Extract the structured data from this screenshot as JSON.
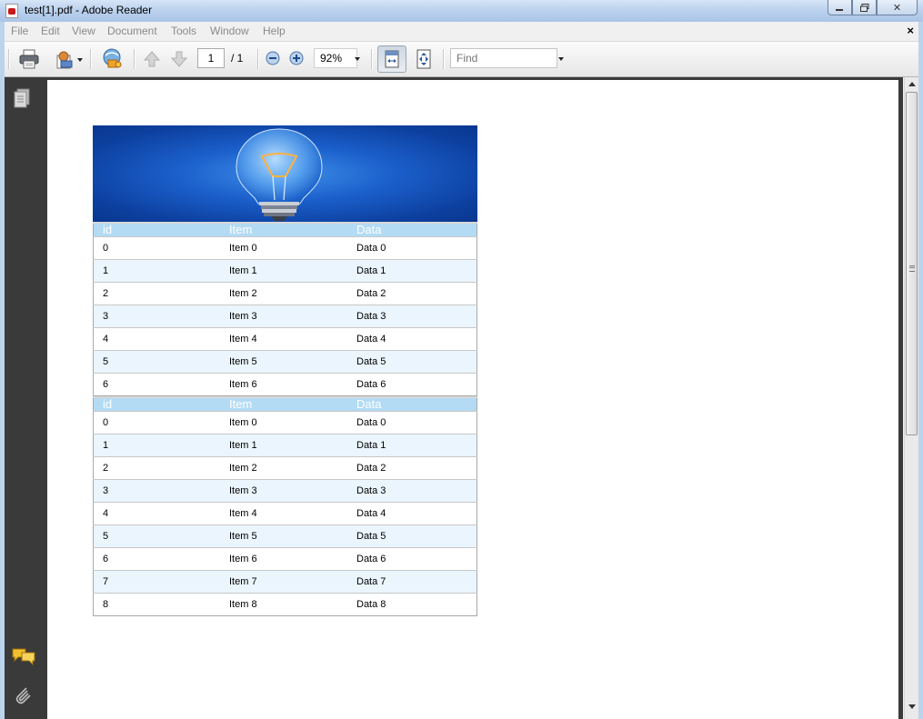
{
  "window": {
    "title": "test[1].pdf - Adobe Reader",
    "close_glyph": "✕"
  },
  "menu": {
    "items": [
      "File",
      "Edit",
      "View",
      "Document",
      "Tools",
      "Window",
      "Help"
    ],
    "close_glyph": "×"
  },
  "toolbar": {
    "page_current": "1",
    "page_total": "/ 1",
    "zoom": "92%",
    "find_placeholder": "Find",
    "icons": [
      "print-icon",
      "pdf-create-icon",
      "collaborate-icon",
      "previous-page-icon",
      "next-page-icon",
      "zoom-out-icon",
      "zoom-in-icon",
      "fit-width-icon",
      "fit-page-icon"
    ]
  },
  "leftnav": {
    "icons": [
      "pages-icon",
      "comments-icon",
      "attachments-icon"
    ]
  },
  "document": {
    "table1": {
      "headers": [
        "id",
        "Item",
        "Data"
      ],
      "rows": [
        [
          "0",
          "Item 0",
          "Data 0"
        ],
        [
          "1",
          "Item 1",
          "Data 1"
        ],
        [
          "2",
          "Item 2",
          "Data 2"
        ],
        [
          "3",
          "Item 3",
          "Data 3"
        ],
        [
          "4",
          "Item 4",
          "Data 4"
        ],
        [
          "5",
          "Item 5",
          "Data 5"
        ],
        [
          "6",
          "Item 6",
          "Data 6"
        ]
      ]
    },
    "table2": {
      "headers": [
        "id",
        "Item",
        "Data"
      ],
      "rows": [
        [
          "0",
          "Item 0",
          "Data 0"
        ],
        [
          "1",
          "Item 1",
          "Data 1"
        ],
        [
          "2",
          "Item 2",
          "Data 2"
        ],
        [
          "3",
          "Item 3",
          "Data 3"
        ],
        [
          "4",
          "Item 4",
          "Data 4"
        ],
        [
          "5",
          "Item 5",
          "Data 5"
        ],
        [
          "6",
          "Item 6",
          "Data 6"
        ],
        [
          "7",
          "Item 7",
          "Data 7"
        ],
        [
          "8",
          "Item 8",
          "Data 8"
        ]
      ]
    }
  }
}
